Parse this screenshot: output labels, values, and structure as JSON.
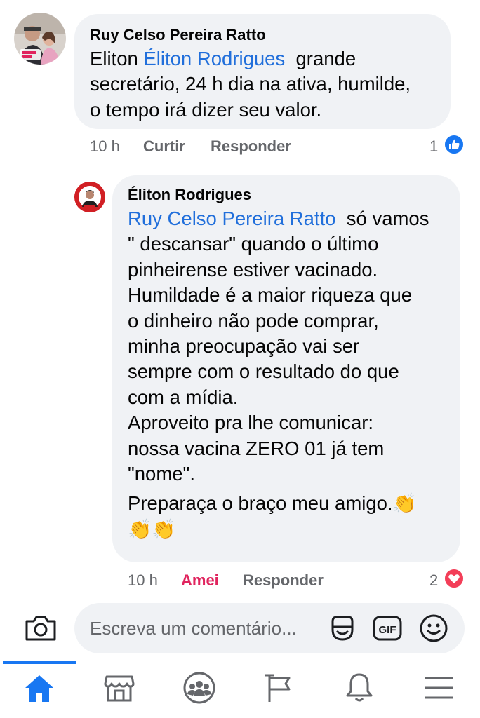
{
  "comments": [
    {
      "author": "Ruy Celso Pereira Ratto",
      "lines": [
        {
          "plain": "Eliton ",
          "mention": "Éliton Rodrigues",
          "rest": "  grande"
        },
        {
          "plain": "secretário, 24 h dia na ativa, humilde,"
        },
        {
          "plain": "o tempo irá dizer seu valor."
        }
      ],
      "time": "10 h",
      "like_label": "Curtir",
      "reply_label": "Responder",
      "reaction_count": "1",
      "reaction_icon": "like-icon",
      "reaction_color": "#1877f2"
    },
    {
      "author": "Éliton Rodrigues",
      "lines": [
        {
          "mention": "Ruy Celso Pereira Ratto",
          "rest": "  só vamos"
        },
        {
          "plain": "\" descansar\" quando o último"
        },
        {
          "plain": "pinheirense estiver vacinado."
        },
        {
          "plain": "Humildade é a maior riqueza que"
        },
        {
          "plain": "o dinheiro não pode comprar,"
        },
        {
          "plain": "minha preocupação vai ser"
        },
        {
          "plain": "sempre com o resultado do que"
        },
        {
          "plain": "com a mídia."
        },
        {
          "plain": "Aproveito pra lhe comunicar:"
        },
        {
          "plain": "nossa vacina ZERO 01 já tem"
        },
        {
          "plain": "\"nome\"."
        },
        {
          "plain": "Preparaça o braço meu amigo.👏"
        },
        {
          "plain": "👏👏"
        }
      ],
      "time": "10 h",
      "like_label": "Amei",
      "reply_label": "Responder",
      "reaction_count": "2",
      "reaction_icon": "heart-icon",
      "reaction_color": "#f33e58",
      "loved_color": "#e0245e"
    }
  ],
  "composer": {
    "placeholder": "Escreva um comentário...",
    "icons": [
      "camera-icon",
      "sticker-icon",
      "gif-icon",
      "emoji-icon"
    ],
    "gif_label": "GIF"
  },
  "tabbar": {
    "active": "home",
    "tabs": [
      "home-icon",
      "marketplace-icon",
      "groups-icon",
      "pages-flag-icon",
      "notifications-bell-icon",
      "menu-icon"
    ],
    "accent": "#1877f2"
  },
  "colors": {
    "mention": "#216fdb",
    "bubble": "#f0f2f5",
    "meta": "#65676b"
  }
}
